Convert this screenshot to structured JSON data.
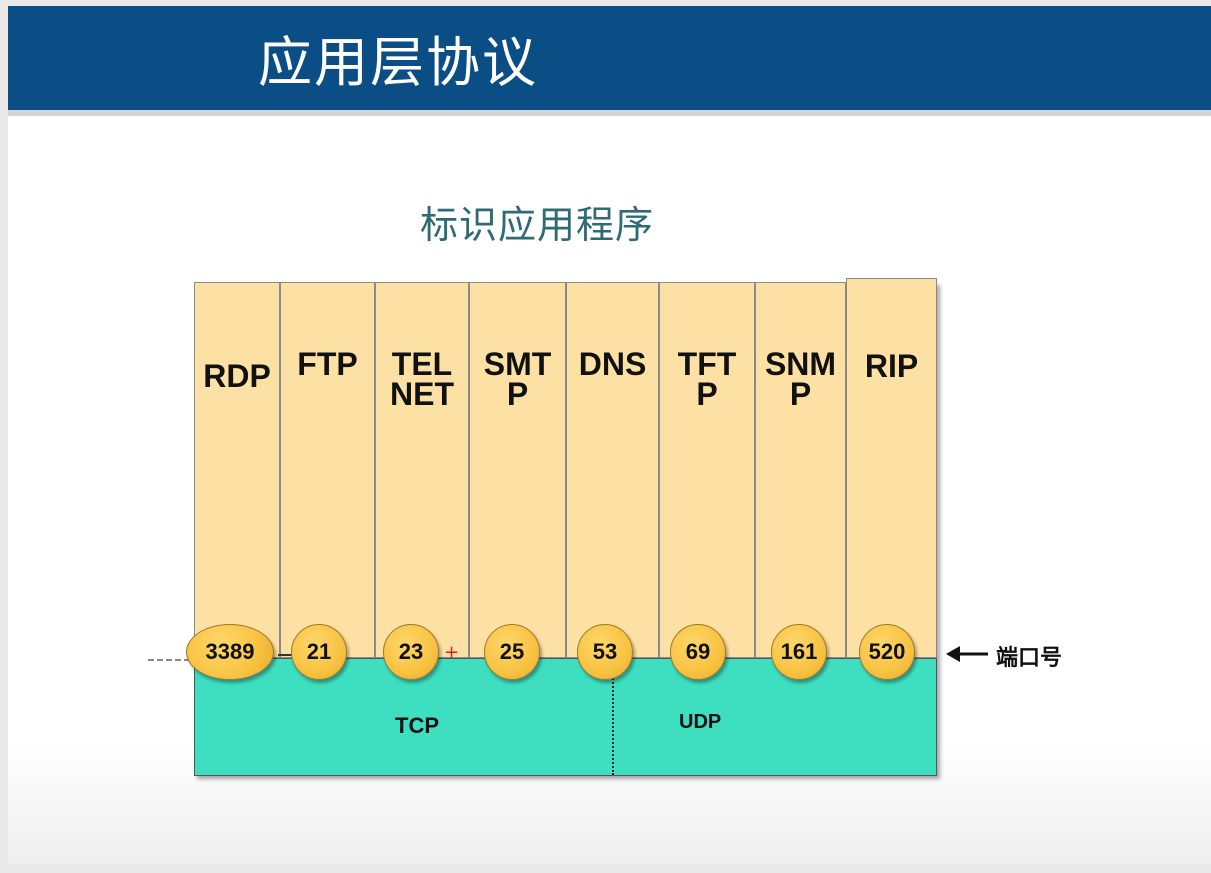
{
  "slide": {
    "title": "应用层协议",
    "header_color": "#0b4e86"
  },
  "diagram": {
    "title": "标识应用程序",
    "protocols": [
      {
        "name": "RDP",
        "port": "3389"
      },
      {
        "name": "FTP",
        "port": "21"
      },
      {
        "name": "TELNET",
        "port": "23"
      },
      {
        "name": "SMTP",
        "port": "25"
      },
      {
        "name": "DNS",
        "port": "53"
      },
      {
        "name": "TFTP",
        "port": "69"
      },
      {
        "name": "SNMP",
        "port": "161"
      },
      {
        "name": "RIP",
        "port": "520"
      }
    ],
    "transport": {
      "tcp_label": "TCP",
      "udp_label": "UDP"
    },
    "port_label": "端口号",
    "colors": {
      "protocol_column": "#fde1a4",
      "transport_band": "#3edfc1",
      "port_circle": "#f8c241"
    }
  }
}
